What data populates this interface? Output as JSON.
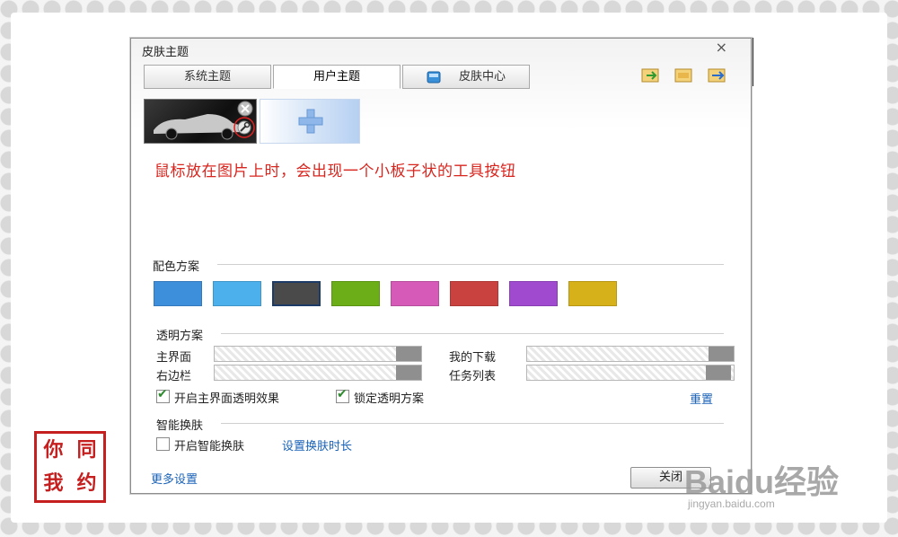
{
  "window": {
    "title": "皮肤主题",
    "close_symbol": "×"
  },
  "tabs": [
    {
      "label": "系统主题"
    },
    {
      "label": "用户主题"
    },
    {
      "label": "皮肤中心"
    }
  ],
  "active_tab": "用户主题",
  "toolbar_icons": [
    "import-skin-icon",
    "export-skin-icon",
    "share-skin-icon"
  ],
  "annotation": "鼠标放在图片上时，会出现一个小板子状的工具按钮",
  "color_scheme": {
    "label": "配色方案",
    "swatches": [
      "#3d8fdc",
      "#4cb0ec",
      "#4a4a4a",
      "#6bae18",
      "#d65ab8",
      "#c9423f",
      "#a04ad0",
      "#d7b11a"
    ],
    "selected_index": 2
  },
  "transparency": {
    "label": "透明方案",
    "sliders": [
      {
        "label": "主界面"
      },
      {
        "label": "我的下载"
      },
      {
        "label": "右边栏"
      },
      {
        "label": "任务列表"
      }
    ],
    "options": [
      {
        "label": "开启主界面透明效果",
        "checked": true
      },
      {
        "label": "锁定透明方案",
        "checked": true
      }
    ],
    "reset_label": "重置"
  },
  "smart_skin": {
    "label": "智能换肤",
    "option_label": "开启智能换肤",
    "option_checked": false,
    "duration_link": "设置换肤时长"
  },
  "footer": {
    "more_settings": "更多设置",
    "close_button": "关闭"
  },
  "seal": [
    "你",
    "同",
    "我",
    "约"
  ],
  "watermark": {
    "brand": "Baidu经验",
    "url": "jingyan.baidu.com"
  }
}
